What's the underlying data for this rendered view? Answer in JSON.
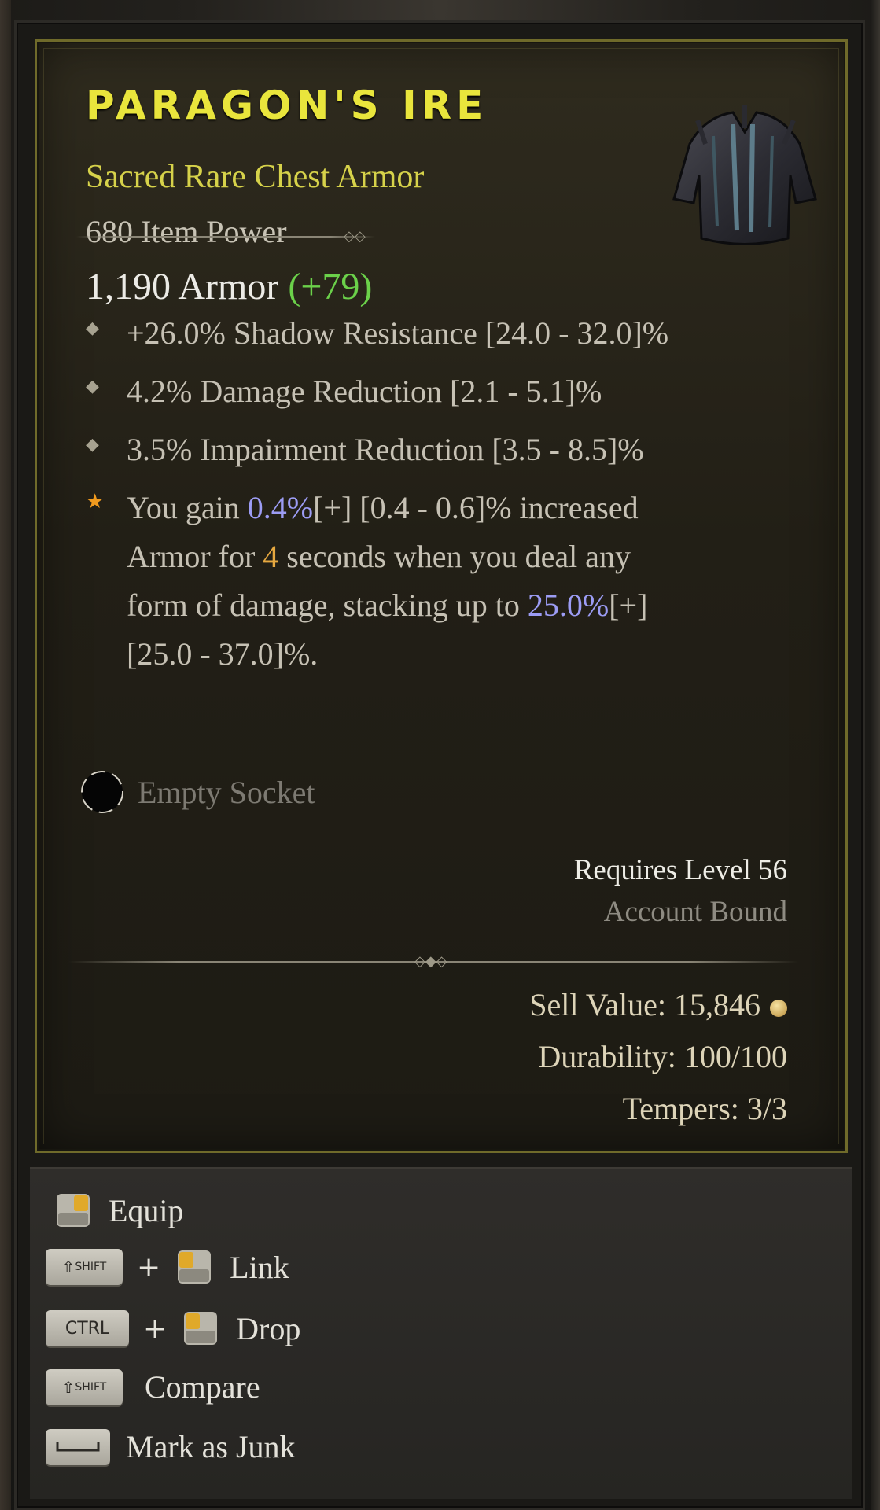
{
  "item": {
    "name": "PARAGON'S IRE",
    "type": "Sacred Rare Chest Armor",
    "power": "680 Item Power",
    "image_icon": "chest-armor-icon"
  },
  "armor": {
    "value": "1,190 Armor",
    "bonus": "(+79)"
  },
  "affixes": [
    {
      "text": "+26.0% Shadow Resistance [24.0 - 32.0]%"
    },
    {
      "text": "4.2% Damage Reduction [2.1 - 5.1]%"
    },
    {
      "text": "3.5% Impairment Reduction [3.5 - 8.5]%"
    }
  ],
  "aspect": {
    "line1_pre": "You gain ",
    "line1_hl": "0.4%",
    "line1_post": "[+] [0.4 - 0.6]% increased",
    "line2_pre": "Armor for ",
    "line2_num": "4",
    "line2_post": " seconds when you deal any",
    "line3_pre": "form of damage, stacking up to ",
    "line3_hl": "25.0%",
    "line3_post": "[+]",
    "line4": "[25.0 - 37.0]%."
  },
  "socket": {
    "label": "Empty Socket"
  },
  "requirements": {
    "level": "Requires Level 56",
    "bound": "Account Bound"
  },
  "meta": {
    "sell_value": "Sell Value: 15,846",
    "durability": "Durability: 100/100",
    "tempers": "Tempers: 3/3"
  },
  "controls": {
    "equip": "Equip",
    "link": "Link",
    "drop": "Drop",
    "compare": "Compare",
    "junk": "Mark as Junk",
    "shift_key": "SHIFT",
    "ctrl_key": "CTRL",
    "plus": "+"
  },
  "colors": {
    "title": "#e9e53c",
    "rare": "#d6d24a",
    "bonus_green": "#6bd14a",
    "highlight_blue": "#9c9cf4",
    "number_orange": "#e6a840"
  }
}
